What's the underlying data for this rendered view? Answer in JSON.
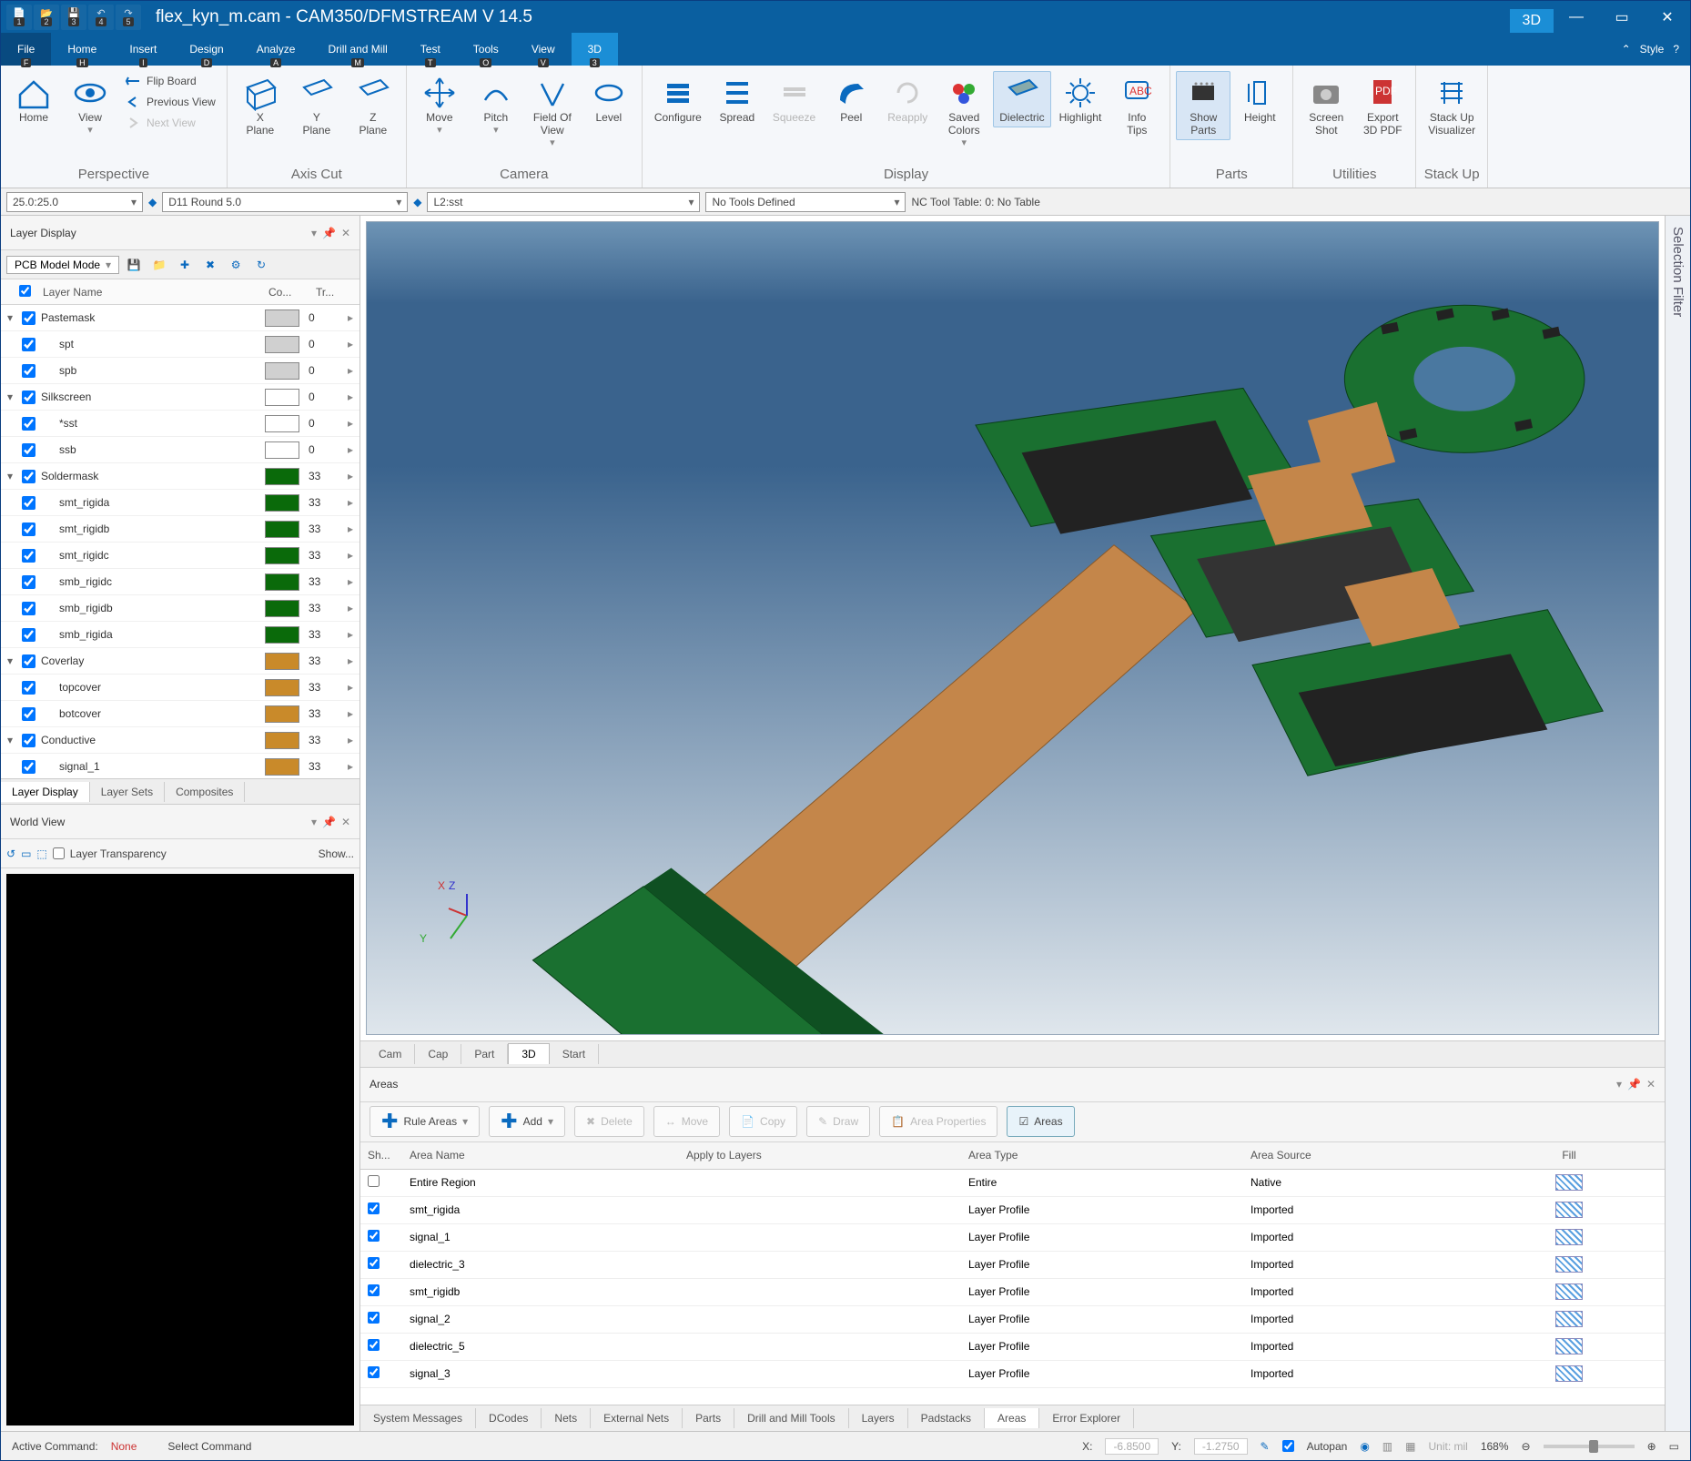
{
  "title": "flex_kyn_m.cam - CAM350/DFMSTREAM V 14.5",
  "qat": [
    "1",
    "2",
    "3",
    "4",
    "5"
  ],
  "menu": {
    "items": [
      "File",
      "Home",
      "Insert",
      "Design",
      "Analyze",
      "Drill and Mill",
      "Test",
      "Tools",
      "View",
      "3D"
    ],
    "keys": [
      "F",
      "H",
      "I",
      "D",
      "A",
      "M",
      "T",
      "O",
      "V",
      "3"
    ],
    "activeIndex": 9,
    "style": "Style"
  },
  "ribbon": {
    "perspective": {
      "home": "Home",
      "view": "View",
      "flip": "Flip Board",
      "prev": "Previous View",
      "next": "Next View",
      "label": "Perspective"
    },
    "axis": {
      "x": "X\nPlane",
      "y": "Y\nPlane",
      "z": "Z\nPlane",
      "label": "Axis Cut"
    },
    "camera": {
      "move": "Move",
      "pitch": "Pitch",
      "fov": "Field Of\nView",
      "level": "Level",
      "label": "Camera"
    },
    "display": {
      "conf": "Configure",
      "spread": "Spread",
      "squeeze": "Squeeze",
      "peel": "Peel",
      "reapply": "Reapply",
      "saved": "Saved\nColors",
      "diel": "Dielectric",
      "hilight": "Highlight",
      "tips": "Info\nTips",
      "label": "Display"
    },
    "parts": {
      "show": "Show\nParts",
      "height": "Height",
      "label": "Parts"
    },
    "util": {
      "sshot": "Screen\nShot",
      "pdf": "Export\n3D PDF",
      "label": "Utilities"
    },
    "stackup": {
      "vis": "Stack Up\nVisualizer",
      "label": "Stack Up"
    }
  },
  "toolrow": {
    "zoom": "25.0:25.0",
    "dcode": "D11   Round 5.0",
    "layer": "L2:sst",
    "tools": "No Tools Defined",
    "nctable": "NC Tool Table: 0: No Table"
  },
  "layerPanel": {
    "title": "Layer Display",
    "mode": "PCB Model Mode",
    "headers": {
      "name": "Layer Name",
      "color": "Co...",
      "trans": "Tr..."
    },
    "rows": [
      {
        "group": "Pastemask",
        "t": "0",
        "sw": "#d0d0d0"
      },
      {
        "child": "spt",
        "t": "0",
        "sw": "#d0d0d0"
      },
      {
        "child": "spb",
        "t": "0",
        "sw": "#d0d0d0"
      },
      {
        "group": "Silkscreen",
        "t": "0",
        "sw": "#ffffff"
      },
      {
        "child": "*sst",
        "t": "0",
        "sw": "#ffffff"
      },
      {
        "child": "ssb",
        "t": "0",
        "sw": "#ffffff"
      },
      {
        "group": "Soldermask",
        "t": "33",
        "sw": "#0a6a0a"
      },
      {
        "child": "smt_rigida",
        "t": "33",
        "sw": "#0a6a0a"
      },
      {
        "child": "smt_rigidb",
        "t": "33",
        "sw": "#0a6a0a"
      },
      {
        "child": "smt_rigidc",
        "t": "33",
        "sw": "#0a6a0a"
      },
      {
        "child": "smb_rigidc",
        "t": "33",
        "sw": "#0a6a0a"
      },
      {
        "child": "smb_rigidb",
        "t": "33",
        "sw": "#0a6a0a"
      },
      {
        "child": "smb_rigida",
        "t": "33",
        "sw": "#0a6a0a"
      },
      {
        "group": "Coverlay",
        "t": "33",
        "sw": "#c98a2a"
      },
      {
        "child": "topcover",
        "t": "33",
        "sw": "#c98a2a"
      },
      {
        "child": "botcover",
        "t": "33",
        "sw": "#c98a2a"
      },
      {
        "group": "Conductive",
        "t": "33",
        "sw": "#c98a2a"
      },
      {
        "child": "signal_1",
        "t": "33",
        "sw": "#c98a2a"
      }
    ],
    "tabs": [
      "Layer Display",
      "Layer Sets",
      "Composites"
    ]
  },
  "worldview": {
    "title": "World View",
    "transparency": "Layer Transparency",
    "show": "Show..."
  },
  "viewtabs": [
    "Cam",
    "Cap",
    "Part",
    "3D",
    "Start"
  ],
  "axis": {
    "x": "X",
    "y": "Y",
    "z": "Z"
  },
  "areas": {
    "title": "Areas",
    "buttons": {
      "rule": "Rule Areas",
      "add": "Add",
      "del": "Delete",
      "move": "Move",
      "copy": "Copy",
      "draw": "Draw",
      "props": "Area Properties",
      "areas": "Areas"
    },
    "headers": {
      "sh": "Sh...",
      "name": "Area Name",
      "apply": "Apply to Layers",
      "type": "Area Type",
      "src": "Area Source",
      "fill": "Fill"
    },
    "rows": [
      {
        "chk": false,
        "name": "Entire Region",
        "apply": "",
        "type": "Entire",
        "src": "Native"
      },
      {
        "chk": true,
        "name": "smt_rigida",
        "apply": "",
        "type": "Layer Profile",
        "src": "Imported"
      },
      {
        "chk": true,
        "name": "signal_1",
        "apply": "",
        "type": "Layer Profile",
        "src": "Imported"
      },
      {
        "chk": true,
        "name": "dielectric_3",
        "apply": "",
        "type": "Layer Profile",
        "src": "Imported"
      },
      {
        "chk": true,
        "name": "smt_rigidb",
        "apply": "",
        "type": "Layer Profile",
        "src": "Imported"
      },
      {
        "chk": true,
        "name": "signal_2",
        "apply": "",
        "type": "Layer Profile",
        "src": "Imported"
      },
      {
        "chk": true,
        "name": "dielectric_5",
        "apply": "",
        "type": "Layer Profile",
        "src": "Imported"
      },
      {
        "chk": true,
        "name": "signal_3",
        "apply": "",
        "type": "Layer Profile",
        "src": "Imported"
      }
    ],
    "bottomTabs": [
      "System Messages",
      "DCodes",
      "Nets",
      "External Nets",
      "Parts",
      "Drill and Mill Tools",
      "Layers",
      "Padstacks",
      "Areas",
      "Error Explorer"
    ]
  },
  "status": {
    "active": "Active Command:",
    "none": "None",
    "select": "Select Command",
    "x": "X:",
    "xv": "-6.8500",
    "y": "Y:",
    "yv": "-1.2750",
    "autopan": "Autopan",
    "unit": "Unit: mil",
    "zoom": "168%"
  },
  "selectionFilter": "Selection Filter"
}
